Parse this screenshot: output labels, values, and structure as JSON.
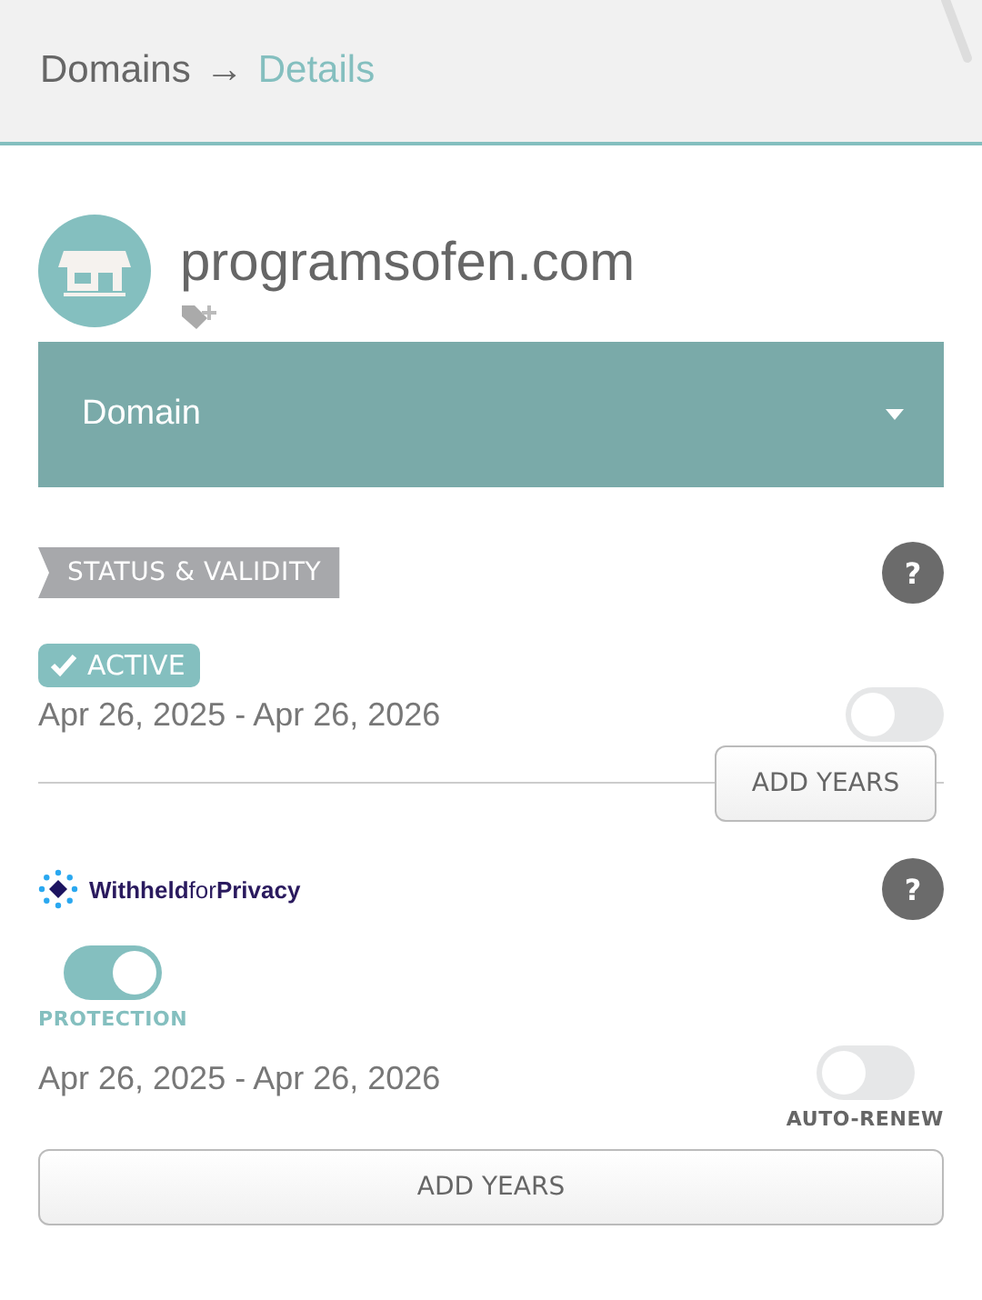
{
  "breadcrumb": {
    "parent": "Domains",
    "separator": "→",
    "current": "Details"
  },
  "domain": {
    "name": "programsofen.com"
  },
  "dropdown": {
    "label": "Domain",
    "expanded": false
  },
  "status": {
    "heading": "STATUS & VALIDITY",
    "help": "?",
    "badge": "ACTIVE",
    "dates": "Apr 26, 2025 - Apr 26, 2026",
    "toggle_on": false,
    "button": "ADD YEARS"
  },
  "privacy": {
    "brand": "**Withheld**for**Privacy**",
    "help": "?",
    "protection_on": true,
    "protection_label": "PROTECTION",
    "dates": "Apr 26, 2025 - Apr 26, 2026",
    "autorenew_on": false,
    "autorenew_label": "AUTO-RENEW",
    "button": "ADD YEARS"
  }
}
